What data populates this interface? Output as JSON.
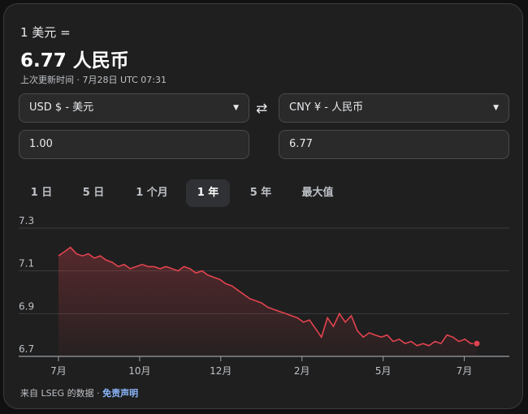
{
  "header": {
    "label": "1 美元 =",
    "rate": "6.77 人民币",
    "updated": "上次更新时间 · 7月28日 UTC 07:31"
  },
  "converter": {
    "from_currency": "USD $ - 美元",
    "to_currency": "CNY ¥ - 人民币",
    "from_value": "1.00",
    "to_value": "6.77",
    "swap_icon": "⇄"
  },
  "tabs": [
    {
      "label": "1 日",
      "active": false
    },
    {
      "label": "5 日",
      "active": false
    },
    {
      "label": "1 个月",
      "active": false
    },
    {
      "label": "1 年",
      "active": true
    },
    {
      "label": "5 年",
      "active": false
    },
    {
      "label": "最大值",
      "active": false
    }
  ],
  "colors": {
    "line": "#e2434f",
    "accent_link": "#8ab4f8"
  },
  "chart_data": {
    "type": "area",
    "ylim": [
      6.7,
      7.3
    ],
    "yticks": [
      "7.3",
      "7.1",
      "6.9",
      "6.7"
    ],
    "xtick_labels": [
      "7月",
      "10月",
      "12月",
      "2月",
      "5月",
      "7月"
    ],
    "xtick_positions": [
      0.0,
      0.1667,
      0.3333,
      0.5,
      0.6667,
      0.8333
    ],
    "series": [
      {
        "values": [
          7.17,
          7.19,
          7.21,
          7.18,
          7.17,
          7.18,
          7.16,
          7.17,
          7.15,
          7.14,
          7.12,
          7.13,
          7.11,
          7.12,
          7.13,
          7.12,
          7.12,
          7.11,
          7.12,
          7.11,
          7.1,
          7.12,
          7.11,
          7.09,
          7.1,
          7.08,
          7.07,
          7.06,
          7.04,
          7.03,
          7.01,
          6.99,
          6.97,
          6.96,
          6.95,
          6.93,
          6.92,
          6.91,
          6.9,
          6.89,
          6.88,
          6.86,
          6.87,
          6.83,
          6.79,
          6.88,
          6.84,
          6.9,
          6.86,
          6.89,
          6.82,
          6.79,
          6.81,
          6.8,
          6.79,
          6.8,
          6.77,
          6.78,
          6.76,
          6.77,
          6.75,
          6.76,
          6.75,
          6.77,
          6.76,
          6.8,
          6.79,
          6.77,
          6.78,
          6.76,
          6.76
        ]
      }
    ]
  },
  "footer": {
    "source": "来自 LSEG 的数据 · ",
    "disclaimer": "免责声明"
  }
}
